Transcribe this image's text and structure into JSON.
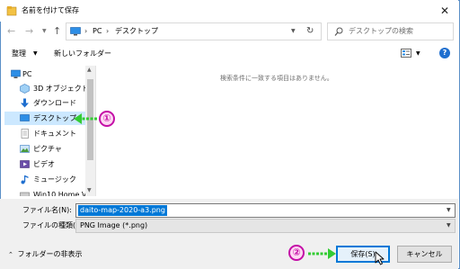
{
  "window": {
    "title": "名前を付けて保存",
    "close_glyph": "✕"
  },
  "address": {
    "crumbs": [
      "PC",
      "デスクトップ"
    ],
    "separator": "›",
    "search_placeholder": "デスクトップの検索"
  },
  "toolbar": {
    "organize_label": "整理",
    "new_folder_label": "新しいフォルダー",
    "help_glyph": "?"
  },
  "sidebar": {
    "items": [
      {
        "label": "PC",
        "icon": "pc-icon"
      },
      {
        "label": "3D オブジェクト",
        "icon": "3d-objects-icon"
      },
      {
        "label": "ダウンロード",
        "icon": "download-icon"
      },
      {
        "label": "デスクトップ",
        "icon": "desktop-icon",
        "selected": true
      },
      {
        "label": "ドキュメント",
        "icon": "documents-icon"
      },
      {
        "label": "ピクチャ",
        "icon": "pictures-icon"
      },
      {
        "label": "ビデオ",
        "icon": "videos-icon"
      },
      {
        "label": "ミュージック",
        "icon": "music-icon"
      },
      {
        "label": "Win10 Home Ve",
        "icon": "drive-icon"
      }
    ]
  },
  "content": {
    "empty_message": "検索条件に一致する項目はありません。"
  },
  "form": {
    "filename_label": "ファイル名(N):",
    "filename_value": "daito-map-2020-a3.png",
    "filetype_label": "ファイルの種類(T):",
    "filetype_value": "PNG Image (*.png)"
  },
  "footer": {
    "hide_folders_label": "フォルダーの非表示",
    "save_label": "保存(S)",
    "cancel_label": "キャンセル"
  },
  "annotations": {
    "step1": "①",
    "step2": "②"
  },
  "colors": {
    "selection": "#cce8ff",
    "accent": "#0078d7",
    "annotation": "#c40fa7",
    "arrow": "#33cc33"
  }
}
